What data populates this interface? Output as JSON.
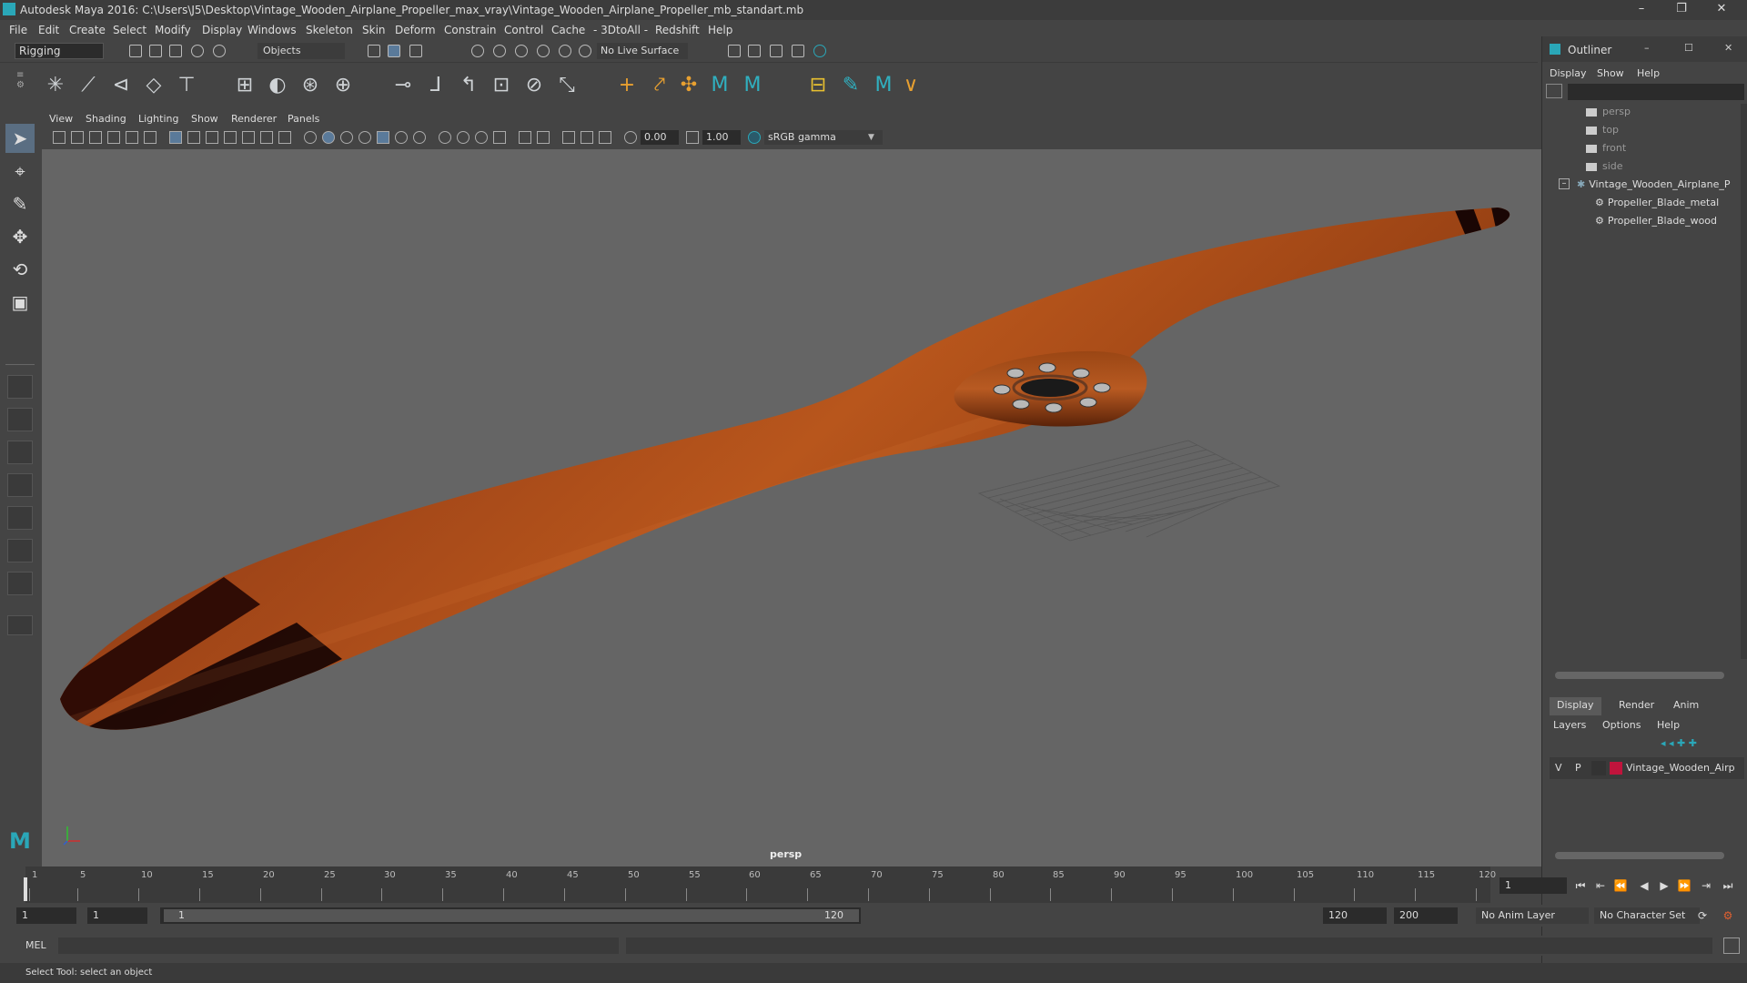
{
  "window": {
    "title": "Autodesk Maya 2016: C:\\Users\\J5\\Desktop\\Vintage_Wooden_Airplane_Propeller_max_vray\\Vintage_Wooden_Airplane_Propeller_mb_standart.mb",
    "minimize": "–",
    "restore": "❐",
    "close": "✕"
  },
  "menu": [
    "File",
    "Edit",
    "Create",
    "Select",
    "Modify",
    "Display",
    "Windows",
    "Skeleton",
    "Skin",
    "Deform",
    "Constrain",
    "Control",
    "Cache",
    "- 3DtoAll -",
    "Redshift",
    "Help"
  ],
  "status_line": {
    "mode": "Rigging",
    "selection_mode": "Objects",
    "live_surface": "No Live Surface"
  },
  "panel_menu": [
    "View",
    "Shading",
    "Lighting",
    "Show",
    "Renderer",
    "Panels"
  ],
  "panel_toolbar": {
    "exposure": "0.00",
    "gamma": "1.00",
    "color_space": "sRGB gamma"
  },
  "viewport": {
    "camera_label": "persp"
  },
  "outliner": {
    "title": "Outliner",
    "menu": [
      "Display",
      "Show",
      "Help"
    ],
    "items": [
      {
        "label": "persp",
        "type": "camera"
      },
      {
        "label": "top",
        "type": "camera"
      },
      {
        "label": "front",
        "type": "camera"
      },
      {
        "label": "side",
        "type": "camera"
      },
      {
        "label": "Vintage_Wooden_Airplane_P",
        "type": "group"
      },
      {
        "label": "Propeller_Blade_metal",
        "type": "mesh"
      },
      {
        "label": "Propeller_Blade_wood",
        "type": "mesh"
      }
    ]
  },
  "layer_editor": {
    "tabs": [
      "Display",
      "Render",
      "Anim"
    ],
    "menu": [
      "Layers",
      "Options",
      "Help"
    ],
    "layer": {
      "v": "V",
      "p": "P",
      "name": "Vintage_Wooden_Airp",
      "color": "#c0143c"
    }
  },
  "time_slider": {
    "ticks": [
      1,
      5,
      10,
      15,
      20,
      25,
      30,
      35,
      40,
      45,
      50,
      55,
      60,
      65,
      70,
      75,
      80,
      85,
      90,
      95,
      100,
      105,
      110,
      115,
      120
    ],
    "current_frame": "1"
  },
  "range_slider": {
    "start": "1",
    "playback_start": "1",
    "range_start_label": "1",
    "range_end_label": "120",
    "playback_end": "120",
    "end": "200",
    "anim_layer": "No Anim Layer",
    "character_set": "No Character Set"
  },
  "command_line": {
    "label": "MEL"
  },
  "help_line": {
    "text": "Select Tool: select an object"
  }
}
